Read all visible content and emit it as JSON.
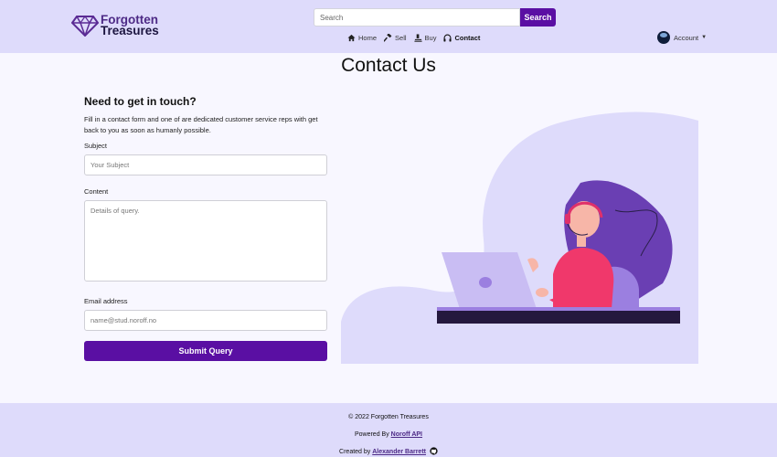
{
  "header": {
    "logo_line1": "Forgotten",
    "logo_line2": "Treasures",
    "search": {
      "placeholder": "Search",
      "button_label": "Search"
    },
    "nav": [
      {
        "label": "Home",
        "icon": "home-icon"
      },
      {
        "label": "Sell",
        "icon": "hammer-icon"
      },
      {
        "label": "Buy",
        "icon": "auction-icon"
      },
      {
        "label": "Contact",
        "icon": "headphones-icon",
        "active": true
      }
    ],
    "account_label": "Account"
  },
  "main": {
    "title": "Contact Us",
    "heading": "Need to get in touch?",
    "description": "Fill in a contact form and one of are dedicated customer service reps with get back to you as soon as humanly possible.",
    "subject": {
      "label": "Subject",
      "placeholder": "Your Subject"
    },
    "content": {
      "label": "Content",
      "placeholder": "Details of query."
    },
    "email": {
      "label": "Email address",
      "placeholder": "name@stud.noroff.no"
    },
    "submit_label": "Submit Query"
  },
  "footer": {
    "copyright": "© 2022 Forgotten Treasures",
    "powered_prefix": "Powered By ",
    "powered_link": "Noroff API",
    "created_prefix": "Created by ",
    "created_link": "Alexander Barrett",
    "github_icon": "github-icon"
  },
  "colors": {
    "brand_purple": "#5a0fa3",
    "header_bg": "#dedbfb",
    "page_bg": "#f8f7ff"
  }
}
